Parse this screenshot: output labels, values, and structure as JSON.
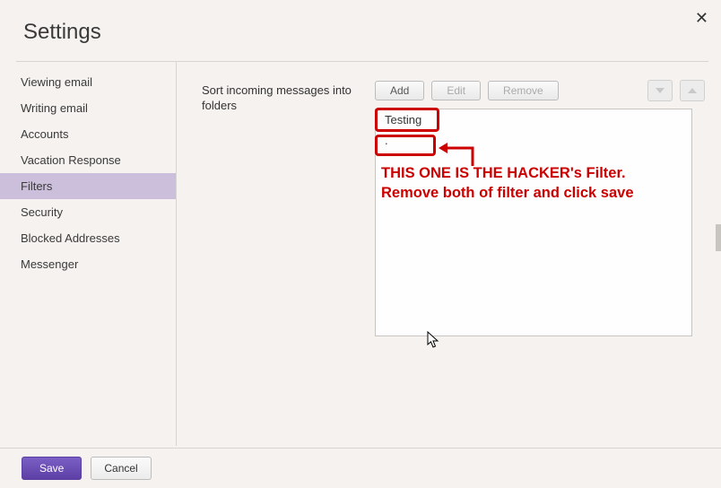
{
  "header": {
    "title": "Settings"
  },
  "sidebar": {
    "items": [
      {
        "label": "Viewing email",
        "selected": false
      },
      {
        "label": "Writing email",
        "selected": false
      },
      {
        "label": "Accounts",
        "selected": false
      },
      {
        "label": "Vacation Response",
        "selected": false
      },
      {
        "label": "Filters",
        "selected": true
      },
      {
        "label": "Security",
        "selected": false
      },
      {
        "label": "Blocked Addresses",
        "selected": false
      },
      {
        "label": "Messenger",
        "selected": false
      }
    ]
  },
  "main": {
    "section_label": "Sort incoming messages into folders",
    "buttons": {
      "add": "Add",
      "edit": "Edit",
      "remove": "Remove"
    },
    "filters": [
      {
        "name": "Testing"
      },
      {
        "name": "."
      }
    ]
  },
  "annotation": {
    "line1": "THIS ONE IS THE HACKER's Filter.",
    "line2": "Remove both of filter and click save"
  },
  "footer": {
    "save": "Save",
    "cancel": "Cancel"
  },
  "colors": {
    "accent": "#6b4fb5",
    "annotation": "#cc0000",
    "selected_bg": "#ccbfdb"
  }
}
